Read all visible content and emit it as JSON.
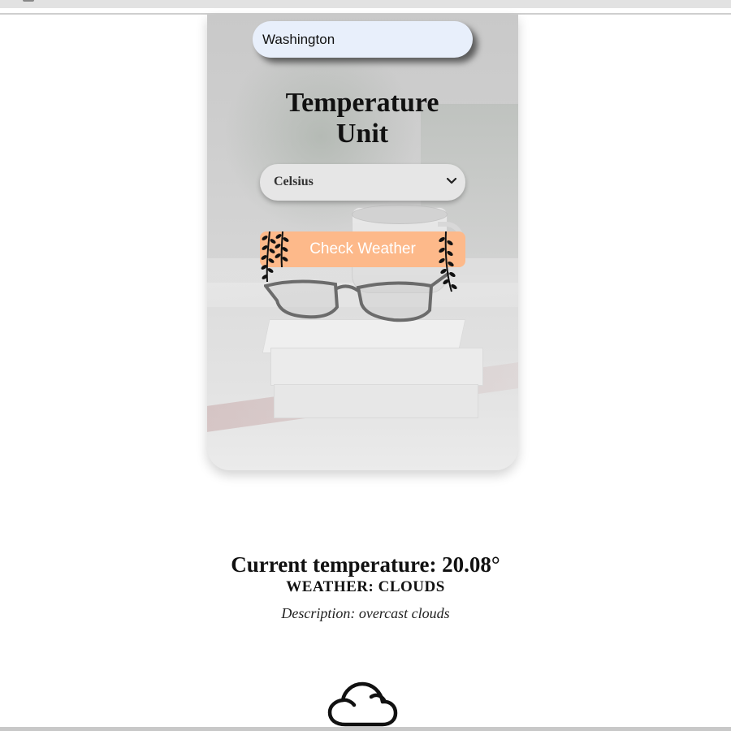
{
  "search": {
    "value": "Washington"
  },
  "unit_section": {
    "heading_line1": "Temperature",
    "heading_line2": "Unit",
    "selected_unit": "Celsius"
  },
  "actions": {
    "check_label": "Check Weather"
  },
  "result": {
    "temperature_text": "Current temperature: 20.08°",
    "weather_text": "WEATHER: CLOUDS",
    "description_text": "Description: overcast clouds",
    "weather_icon": "cloud-icon"
  },
  "colors": {
    "button": "#fdb98a",
    "input_bg": "#e8effb",
    "select_bg": "#e6e6e6"
  }
}
